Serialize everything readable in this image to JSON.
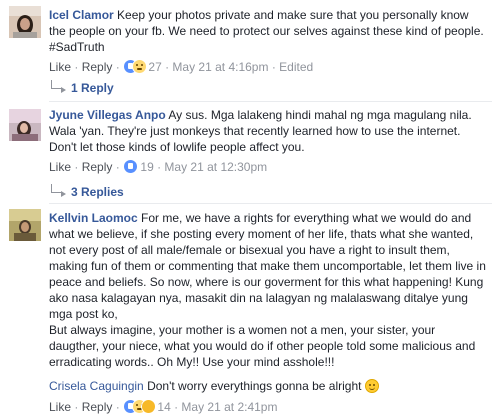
{
  "comments": [
    {
      "author": "Icel Clamor",
      "text": "Keep your photos private and make sure that you personally know the people on your fb. We need to protect our selves against these kind of people. #SadTruth",
      "like_label": "Like",
      "reply_label": "Reply",
      "reaction_count": "27",
      "timestamp": "May 21 at 4:16pm",
      "edited_label": "Edited",
      "replies_label": "1 Reply"
    },
    {
      "author": "Jyune Villegas Anpo",
      "text": "Ay sus. Mga lalakeng hindi mahal ng mga magulang nila. Wala 'yan. They're just monkeys that recently learned how to use the internet. Don't let those kinds of lowlife people affect you.",
      "like_label": "Like",
      "reply_label": "Reply",
      "reaction_count": "19",
      "timestamp": "May 21 at 12:30pm",
      "replies_label": "3 Replies"
    },
    {
      "author": "Kellvin Laomoc",
      "text": "For me, we have a rights for everything what we would do and what we believe, if she posting every moment of her life, thats what she wanted, not every post of all male/female or bisexual you have a right to insult them, making fun of them or commenting that make them uncomportable, let them live in peace and beliefs. So now, where is our goverment for this what happening! Kung ako nasa kalagayan nya, masakit din na lalagyan ng malalaswang ditalye yung mga post ko,",
      "text2": "But always imagine, your mother is a women not a men, your sister, your daugther, your niece, what you would do if other people told some malicious and erradicating words.. Oh My!! Use your mind asshole!!!",
      "reply_author": "Crisela Caguingin",
      "reply_text": "Don't worry everythings gonna be alright",
      "like_label": "Like",
      "reply_label": "Reply",
      "reaction_count": "14",
      "timestamp": "May 21 at 2:41pm"
    }
  ],
  "colors": {
    "link": "#365899",
    "meta": "#90949c",
    "text": "#1d2129"
  },
  "icons": [
    "like-reaction-icon",
    "haha-reaction-icon",
    "reply-arrow-icon",
    "smile-emoji-icon"
  ]
}
